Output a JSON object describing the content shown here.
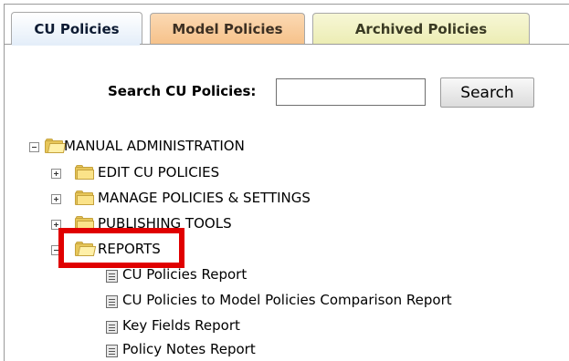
{
  "tabs": [
    {
      "label": "CU Policies",
      "active": true
    },
    {
      "label": "Model Policies",
      "active": false
    },
    {
      "label": "Archived Policies",
      "active": false
    }
  ],
  "search": {
    "label": "Search CU Policies:",
    "value": "",
    "placeholder": "",
    "button_label": "Search"
  },
  "tree": {
    "root": {
      "label": "MANUAL ADMINISTRATION",
      "expanded": true
    },
    "children": [
      {
        "label": "EDIT CU POLICIES",
        "expanded": false
      },
      {
        "label": "MANAGE POLICIES & SETTINGS",
        "expanded": false
      },
      {
        "label": "PUBLISHING TOOLS",
        "expanded": false
      },
      {
        "label": "REPORTS",
        "expanded": true,
        "highlighted": true
      }
    ],
    "reports": [
      {
        "label": "CU Policies Report"
      },
      {
        "label": "CU Policies to Model Policies Comparison Report"
      },
      {
        "label": "Key Fields Report"
      },
      {
        "label": "Policy Notes Report"
      }
    ]
  },
  "colors": {
    "highlight": "#e00000",
    "tab_active": "#e4eef9",
    "tab_model": "#f6c28b",
    "tab_archived": "#ecedb4",
    "folder": "#e7c659"
  },
  "icons": {
    "expand": "plus-box-icon",
    "collapse": "minus-box-icon",
    "folder": "folder-icon",
    "folder_open": "folder-open-icon",
    "report": "document-icon"
  }
}
